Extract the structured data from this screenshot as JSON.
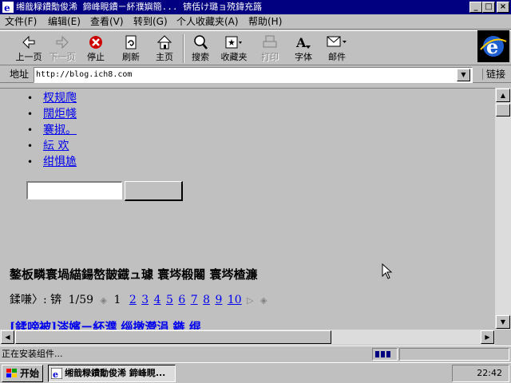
{
  "window": {
    "title": "缃戠粶鐨勪俊浠  鍗峰睍鐨ㄧ紑濮嬩簡... 锛佸け璐ョ殑鍏充簬"
  },
  "window_controls": {
    "minimize": "_",
    "maximize": "□",
    "close": "×"
  },
  "menu": [
    {
      "label": "文件(F)"
    },
    {
      "label": "编辑(E)"
    },
    {
      "label": "查看(V)"
    },
    {
      "label": "转到(G)"
    },
    {
      "label": "个人收藏夹(A)"
    },
    {
      "label": "帮助(H)"
    }
  ],
  "toolbar": {
    "back": "上一页",
    "forward": "下一页",
    "stop": "停止",
    "refresh": "刷新",
    "home": "主页",
    "search": "搜索",
    "favorites": "收藏夹",
    "print": "打印",
    "font": "字体",
    "mail": "邮件"
  },
  "address": {
    "label": "地址",
    "url": "http://blog.ich8.com",
    "links_label": "链接"
  },
  "page": {
    "nav_links": [
      "杈规爮",
      "闊炬帴",
      "褰掓。",
      "紜  欢",
      "绀惧尯"
    ],
    "section_title": "鏊板疄寰堝緢鍚嶅皵鐡ュ璩  寰埁椴闂   寰埁楂濂",
    "pager": {
      "label": "鍒嗛〉: 锛",
      "count": "1/59",
      "prev_symbol": "◈",
      "next_symbol": "▷",
      "last_symbol": "◈",
      "current": "1",
      "pages": [
        "2",
        "3",
        "4",
        "5",
        "6",
        "7",
        "8",
        "9",
        "10"
      ]
    },
    "post_title": "[鍒嗙被]涔嬪ㄧ紑濮   缁撴瀯涓  鏃   绲"
  },
  "status": {
    "text": "正在安装组件..."
  },
  "taskbar": {
    "start": "开始",
    "task": "缃戠粶鐨勪俊浠  鍗峰睍...",
    "clock": "22:42"
  },
  "colors": {
    "titlebar": "#000080",
    "face": "#c0c0c0",
    "link": "#0000ee"
  }
}
